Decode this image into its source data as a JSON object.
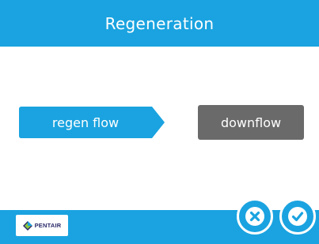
{
  "header": {
    "title": "Regeneration"
  },
  "main": {
    "setting_label": "regen flow",
    "setting_value": "downflow"
  },
  "footer": {
    "logo_text": "PENTAIR",
    "cancel_icon": "close-icon",
    "confirm_icon": "check-icon"
  },
  "colors": {
    "accent": "#1aa3e0",
    "button_gray": "#6a6a6a",
    "background": "#ffffff"
  }
}
